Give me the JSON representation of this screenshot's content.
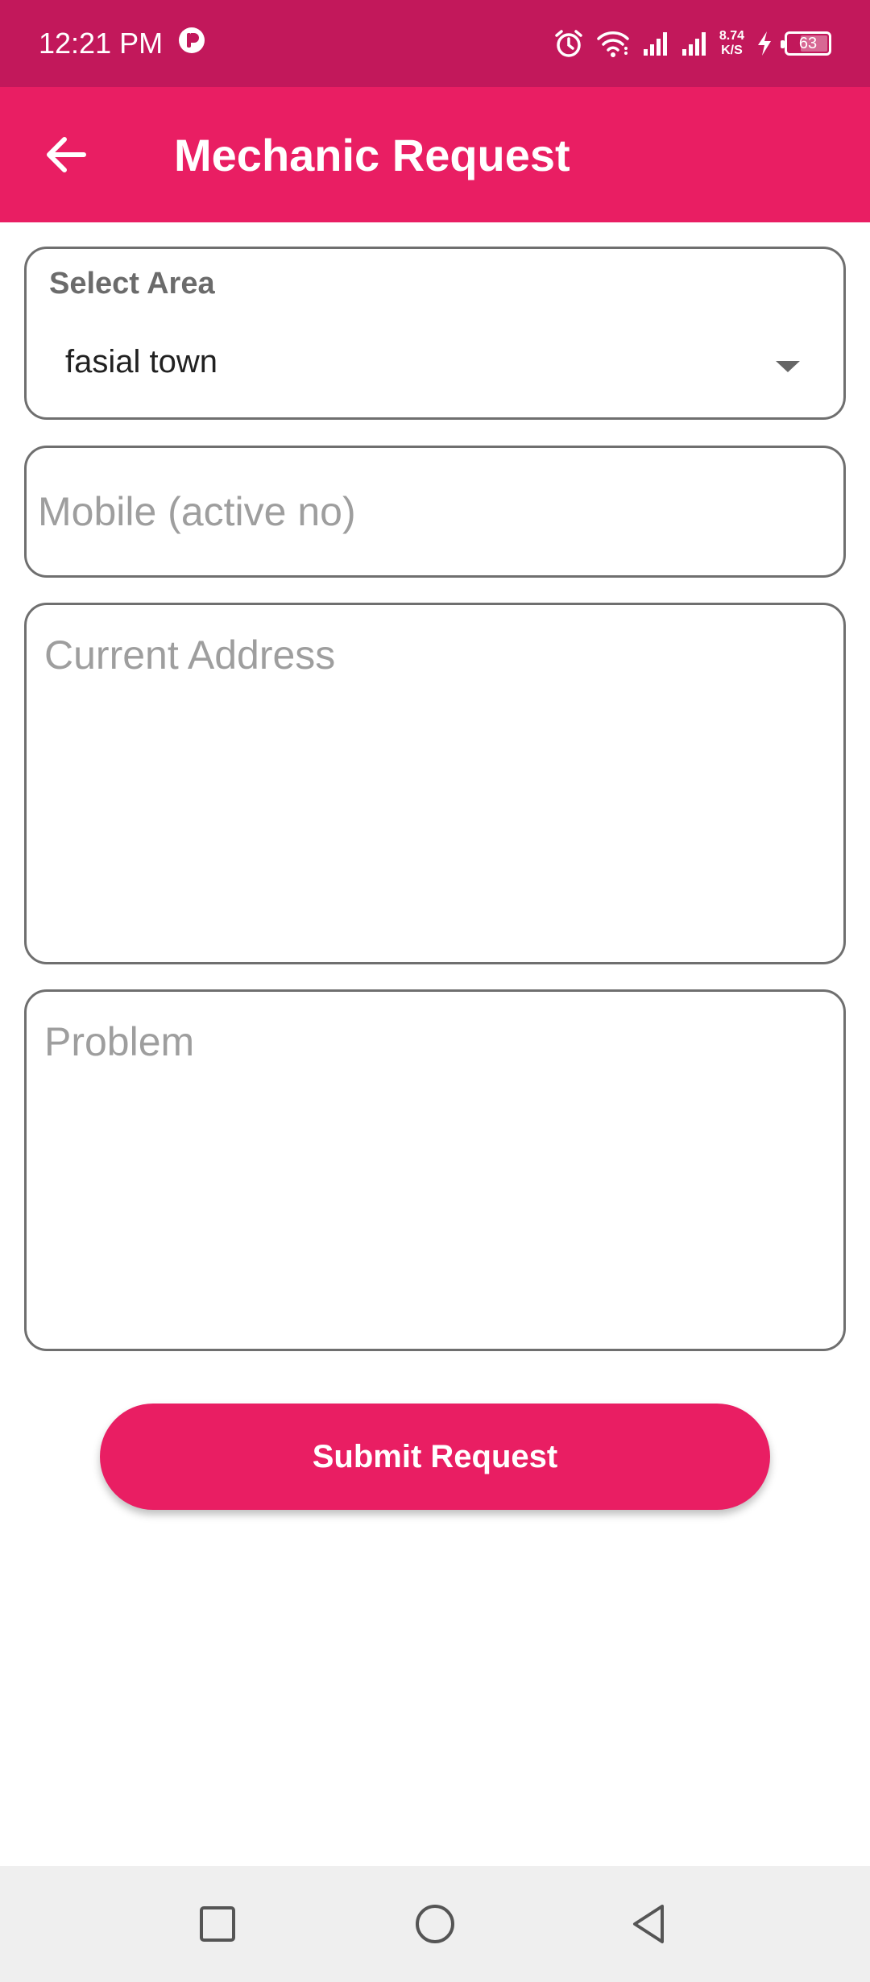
{
  "status_bar": {
    "time": "12:21 PM",
    "net_speed_value": "8.74",
    "net_speed_unit": "K/S",
    "battery_level": "63"
  },
  "app_bar": {
    "title": "Mechanic Request",
    "back_icon": "arrow-left-icon"
  },
  "form": {
    "area": {
      "label": "Select Area",
      "selected": "fasial town"
    },
    "mobile": {
      "placeholder": "Mobile (active no)",
      "value": ""
    },
    "address": {
      "placeholder": "Current Address",
      "value": ""
    },
    "problem": {
      "placeholder": "Problem",
      "value": ""
    },
    "submit_label": "Submit Request"
  },
  "colors": {
    "status_bar": "#c2185b",
    "primary": "#e91e63",
    "field_border": "#6f6f6f",
    "placeholder": "#9e9e9e",
    "nav_bar": "#efefef"
  },
  "nav_bar": {
    "icons": [
      "recent-apps-icon",
      "home-icon",
      "back-triangle-icon"
    ]
  }
}
